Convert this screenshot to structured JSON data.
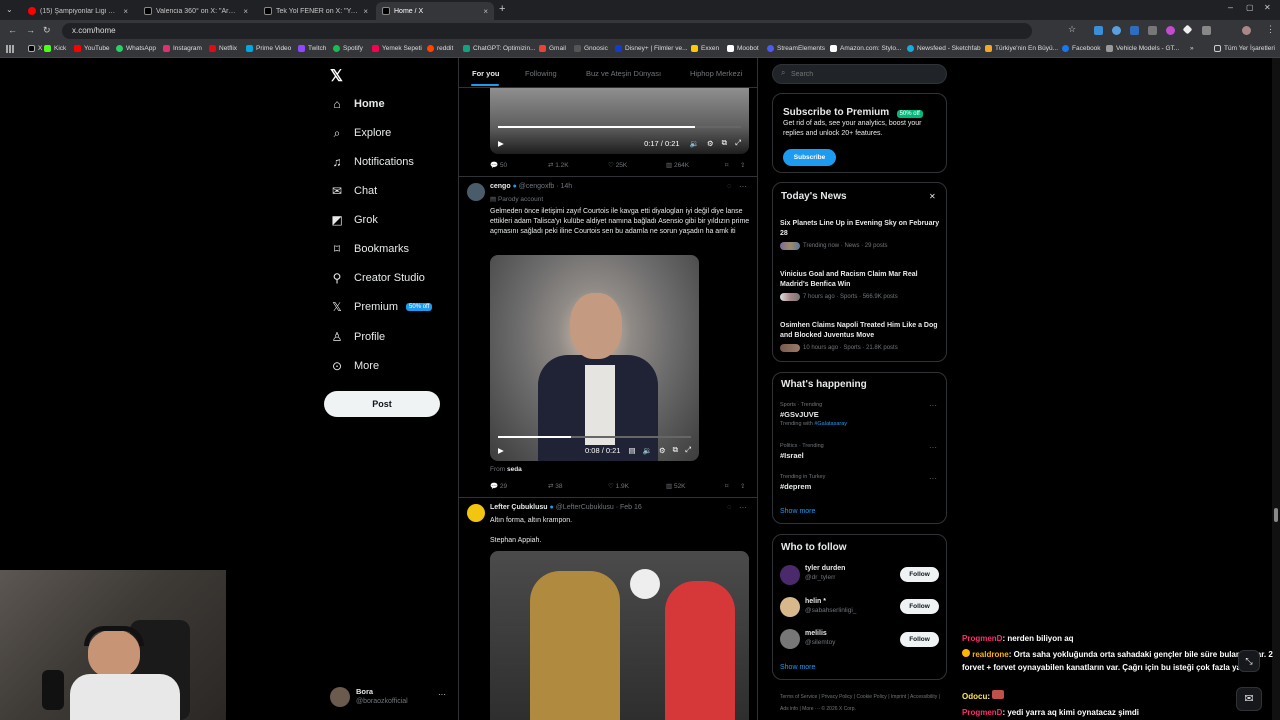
{
  "browser": {
    "tabs": [
      {
        "title": "(15) Şampiyonlar Ligi Son 16 P...",
        "icon": "youtube-icon"
      },
      {
        "title": "Valencia 360° on X: \"Arda Güler...",
        "icon": "x-icon"
      },
      {
        "title": "Tek Yol FENER on X: \"Youssef E...",
        "icon": "x-icon"
      },
      {
        "title": "Home / X",
        "icon": "x-icon"
      }
    ],
    "close_glyph": "×",
    "new_tab_glyph": "+",
    "url": "x.com/home",
    "bookmarks": [
      "X",
      "Kick",
      "YouTube",
      "WhatsApp",
      "Instagram",
      "Netflix",
      "Prime Video",
      "Twitch",
      "Spotify",
      "Yemek Sepeti",
      "reddit",
      "ChatGPT: Optimizin...",
      "Gmail",
      "Gnoosic",
      "Disney+ | Filmler ve...",
      "Exxen",
      "Moobot",
      "StreamElements",
      "Amazon.com: Stylo...",
      "Newsfeed - Sketchfab",
      "Türkiye'nin En Büyü...",
      "Facebook",
      "Vehicle Models - GT..."
    ],
    "all_bookmarks": "Tüm Yer İşaretleri"
  },
  "nav": {
    "items": [
      "Home",
      "Explore",
      "Notifications",
      "Chat",
      "Grok",
      "Bookmarks",
      "Creator Studio",
      "Premium",
      "Profile",
      "More"
    ],
    "premium_badge": "50% off",
    "post": "Post",
    "user_name": "Bora",
    "user_handle": "@boraozkofficial",
    "more_glyph": "···"
  },
  "feed": {
    "tabs": [
      "For you",
      "Following",
      "Buz ve Ateşin Dünyası",
      "Hiphop Merkezi"
    ],
    "tweet0": {
      "time": "0:17 / 0:21",
      "replies": "50",
      "retweets": "1.2K",
      "likes": "25K",
      "views": "264K"
    },
    "tweet1": {
      "name": "cengo",
      "handle": "@cengoxfb · 14h",
      "label": "Parody account",
      "text": "Gelmeden önce iletişimi zayıf Courtois ile kavga etti diyalogları iyi değil diye lanse ettikleri adam Talisca'yı kulübe aldiyet namına bağladı Asensio gibi bir yıldızın prime açmasını sağladı peki iline Courtois sen bu adamla ne sorun yaşadın ha amk iti",
      "time": "0:08 / 0:21",
      "from_label": "From",
      "from_user": "seda",
      "replies": "29",
      "retweets": "38",
      "likes": "1.9K",
      "views": "52K"
    },
    "tweet2": {
      "name": "Lefter Çubuklusu",
      "handle": "@LefterCubuklusu · Feb 16",
      "text1": "Altın forma, altın krampon.",
      "text2": "Stephan Appiah."
    }
  },
  "right": {
    "search_placeholder": "Search",
    "premium": {
      "title": "Subscribe to Premium",
      "badge": "50% off",
      "body": "Get rid of ads, see your analytics, boost your replies and unlock 20+ features.",
      "button": "Subscribe"
    },
    "news": {
      "title": "Today's News",
      "close_glyph": "✕",
      "items": [
        {
          "headline": "Six Planets Line Up in Evening Sky on February 28",
          "meta": "Trending now · News · 29 posts"
        },
        {
          "headline": "Vinicius Goal and Racism Claim Mar Real Madrid's Benfica Win",
          "meta": "7 hours ago · Sports · 566.9K posts"
        },
        {
          "headline": "Osimhen Claims Napoli Treated Him Like a Dog and Blocked Juventus Move",
          "meta": "10 hours ago · Sports · 21.8K posts"
        }
      ]
    },
    "happening": {
      "title": "What's happening",
      "trends": [
        {
          "meta": "Sports · Trending",
          "name": "#GSvJUVE",
          "extra": "Trending with",
          "extra_tag": "#Galatasaray"
        },
        {
          "meta": "Politics · Trending",
          "name": "#Israel"
        },
        {
          "meta": "Trending in Turkey",
          "name": "#deprem"
        }
      ],
      "show_more": "Show more"
    },
    "follow": {
      "title": "Who to follow",
      "users": [
        {
          "name": "tyler durden",
          "handle": "@dr_tylerr"
        },
        {
          "name": "helin *",
          "handle": "@sabahserlinligi_"
        },
        {
          "name": "melilis",
          "handle": "@silemtoy"
        }
      ],
      "button": "Follow",
      "show_more": "Show more"
    },
    "footer": {
      "links": [
        "Terms of Service",
        "Privacy Policy",
        "Cookie Policy",
        "Imprint",
        "Accessibility",
        "Ads info",
        "More ···"
      ],
      "copyright": "© 2026 X Corp."
    }
  },
  "chat": [
    {
      "user": "ProgmenD",
      "msg": ": nerden biliyon aq",
      "color": "#ff2d6f"
    },
    {
      "user": "realdrone",
      "msg": ": Orta saha yokluğunda orta sahadaki gençler bile süre bulamadılar. 2 forvet + forvet oynayabilen kanatların var. Çağrı için bu isteği çok fazla ya",
      "color": "#ffb400"
    },
    {
      "user": "Odocu",
      "msg": ":",
      "color": "#ffe94d"
    },
    {
      "user": "ProgmenD",
      "msg": ": yedi yarra aq kimi oynatacaz şimdi",
      "color": "#ff2d6f"
    }
  ]
}
